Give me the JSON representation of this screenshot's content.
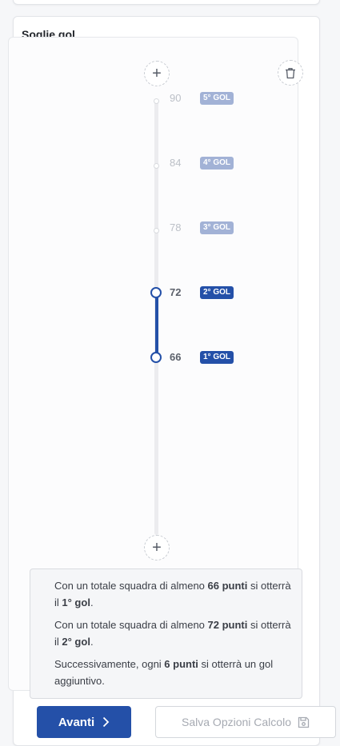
{
  "section": {
    "title": "Soglie gol"
  },
  "thresholds": [
    {
      "value": "90",
      "badge": "5° GOL",
      "active": false
    },
    {
      "value": "84",
      "badge": "4° GOL",
      "active": false
    },
    {
      "value": "78",
      "badge": "3° GOL",
      "active": false
    },
    {
      "value": "72",
      "badge": "2° GOL",
      "active": true
    },
    {
      "value": "66",
      "badge": "1° GOL",
      "active": true
    }
  ],
  "info": {
    "line1": {
      "pre": "Con un totale squadra di almeno ",
      "points": "66 punti",
      "mid": " si otterrà il ",
      "goal": "1° gol",
      "post": "."
    },
    "line2": {
      "pre": "Con un totale squadra di almeno ",
      "points": "72 punti",
      "mid": " si otterrà il ",
      "goal": "2° gol",
      "post": "."
    },
    "line3": {
      "pre": "Successivamente, ogni ",
      "points": "6 punti",
      "post": " si otterrà un gol aggiuntivo."
    }
  },
  "buttons": {
    "next_label": "Avanti",
    "save_label": "Salva Opzioni Calcolo"
  },
  "colors": {
    "accent": "#2450a8",
    "inactive_badge": "#a2b2d6"
  }
}
